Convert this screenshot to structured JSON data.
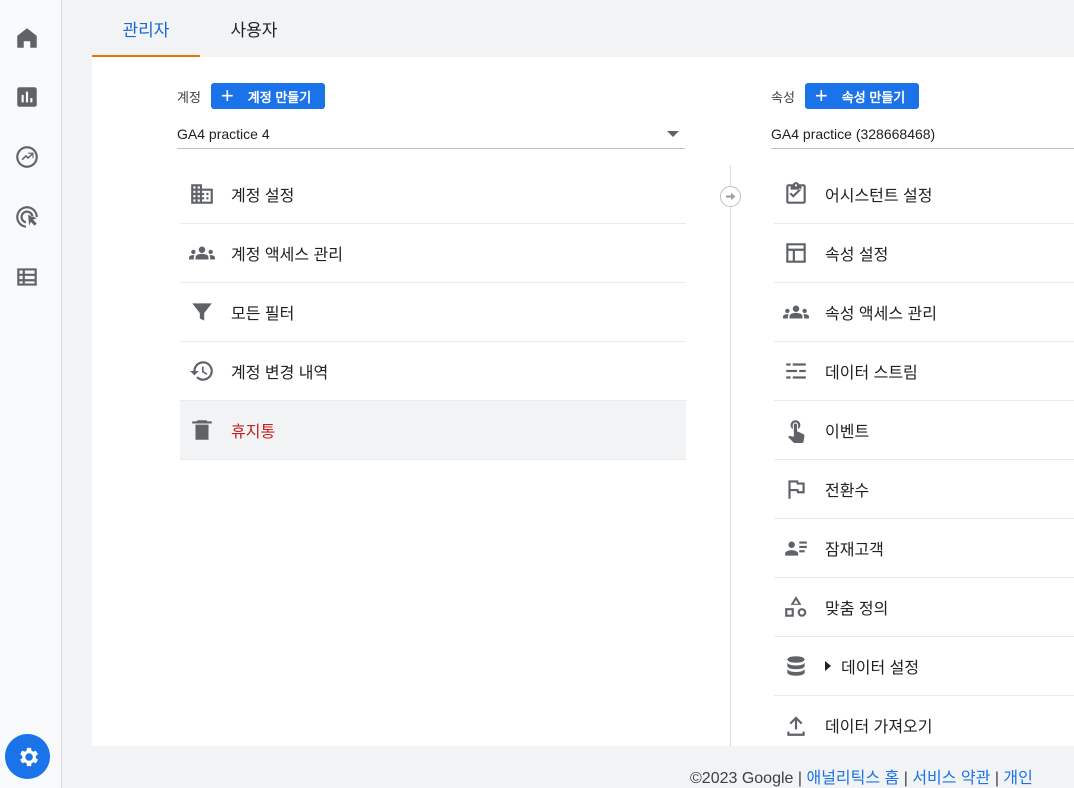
{
  "nav": {
    "items": [
      {
        "name": "home-icon"
      },
      {
        "name": "reports-icon"
      },
      {
        "name": "explore-icon"
      },
      {
        "name": "advertising-icon"
      },
      {
        "name": "configure-icon"
      }
    ],
    "admin": {
      "name": "settings-gear-icon"
    }
  },
  "tabs": {
    "admin": "관리자",
    "user": "사용자"
  },
  "account": {
    "label": "계정",
    "create_button": "계정 만들기",
    "selected": "GA4 practice 4",
    "menu": [
      {
        "label": "계정 설정",
        "icon": "building-icon"
      },
      {
        "label": "계정 액세스 관리",
        "icon": "people-icon"
      },
      {
        "label": "모든 필터",
        "icon": "filter-icon"
      },
      {
        "label": "계정 변경 내역",
        "icon": "history-icon"
      },
      {
        "label": "휴지통",
        "icon": "trash-icon"
      }
    ]
  },
  "property": {
    "label": "속성",
    "create_button": "속성 만들기",
    "selected": "GA4 practice (328668468)",
    "menu": [
      {
        "label": "어시스턴트 설정",
        "icon": "checklist-icon"
      },
      {
        "label": "속성 설정",
        "icon": "layout-icon"
      },
      {
        "label": "속성 액세스 관리",
        "icon": "people-icon"
      },
      {
        "label": "데이터 스트림",
        "icon": "streams-icon"
      },
      {
        "label": "이벤트",
        "icon": "touch-icon"
      },
      {
        "label": "전환수",
        "icon": "flag-icon"
      },
      {
        "label": "잠재고객",
        "icon": "audience-icon"
      },
      {
        "label": "맞춤 정의",
        "icon": "shapes-icon"
      },
      {
        "label": "데이터 설정",
        "icon": "database-icon"
      },
      {
        "label": "데이터 가져오기",
        "icon": "upload-icon"
      }
    ]
  },
  "footer": {
    "copyright": "©2023 Google",
    "sep": "|",
    "links": [
      "애널리틱스 홈",
      "서비스 약관",
      "개인"
    ]
  },
  "colors": {
    "accent": "#1a73e8",
    "tab_indicator": "#e8710a",
    "trash_text": "#c5221f"
  }
}
